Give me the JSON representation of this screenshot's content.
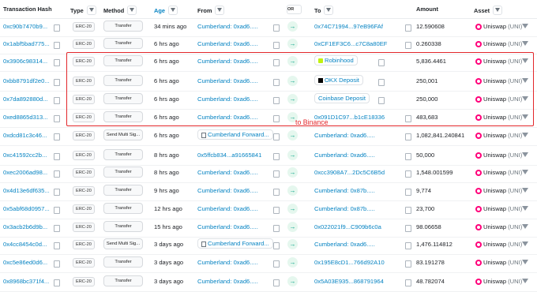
{
  "header": {
    "txhash": "Transaction Hash",
    "type": "Type",
    "method": "Method",
    "age": "Age",
    "from": "From",
    "or": "OR",
    "to": "To",
    "amount": "Amount",
    "asset": "Asset"
  },
  "annotation": "to Binance",
  "colors": {
    "link": "#0784c3",
    "highlight": "#e3272b",
    "in_arrow": "#00a186",
    "uniswap": "#ff007a"
  },
  "rows": [
    {
      "hash": "0xc90b7470b9...",
      "type": "ERC-20",
      "method": "Transfer",
      "age": "34 mins ago",
      "from": "Cumberland: 0xad6.....",
      "to": "0x74C71994...97eB96FAf",
      "amount": "12.590608",
      "asset": "Uniswap",
      "symbol": "(UNI)"
    },
    {
      "hash": "0x1abf5bad775...",
      "type": "ERC-20",
      "method": "Transfer",
      "age": "6 hrs ago",
      "from": "Cumberland: 0xad6.....",
      "to": "0xCF1EF3C6...c7C8a80EF",
      "amount": "0.260338",
      "asset": "Uniswap",
      "symbol": "(UNI)"
    },
    {
      "hash": "0x3906c98314...",
      "type": "ERC-20",
      "method": "Transfer",
      "age": "6 hrs ago",
      "from": "Cumberland: 0xad6.....",
      "to": "Robinhood",
      "amount": "5,836.4461",
      "asset": "Uniswap",
      "symbol": "(UNI)"
    },
    {
      "hash": "0xbb8791df2e0...",
      "type": "ERC-20",
      "method": "Transfer",
      "age": "6 hrs ago",
      "from": "Cumberland: 0xad6.....",
      "to": "OKX Deposit",
      "amount": "250,001",
      "asset": "Uniswap",
      "symbol": "(UNI)"
    },
    {
      "hash": "0x7da892880d...",
      "type": "ERC-20",
      "method": "Transfer",
      "age": "6 hrs ago",
      "from": "Cumberland: 0xad6.....",
      "to": "Coinbase Deposit",
      "amount": "250,000",
      "asset": "Uniswap",
      "symbol": "(UNI)"
    },
    {
      "hash": "0xed8865d313...",
      "type": "ERC-20",
      "method": "Transfer",
      "age": "6 hrs ago",
      "from": "Cumberland: 0xad6.....",
      "to": "0x091D1C97...b1cE18336",
      "amount": "483,683",
      "asset": "Uniswap",
      "symbol": "(UNI)"
    },
    {
      "hash": "0xdcd81c3c46...",
      "type": "ERC-20",
      "method": "Send Multi Sig...",
      "age": "6 hrs ago",
      "from": "Cumberland Forward...",
      "to": "Cumberland: 0xad6.....",
      "amount": "1,082,841.240841",
      "asset": "Uniswap",
      "symbol": "(UNI)"
    },
    {
      "hash": "0xc41592cc2b...",
      "type": "ERC-20",
      "method": "Transfer",
      "age": "8 hrs ago",
      "from": "0x5ffcb834...a91665841",
      "to": "Cumberland: 0xad6.....",
      "amount": "50,000",
      "asset": "Uniswap",
      "symbol": "(UNI)"
    },
    {
      "hash": "0xec2006ad98...",
      "type": "ERC-20",
      "method": "Transfer",
      "age": "8 hrs ago",
      "from": "Cumberland: 0xad6.....",
      "to": "0xcc3908A7...2Dc5C6B5d",
      "amount": "1,548.001599",
      "asset": "Uniswap",
      "symbol": "(UNI)"
    },
    {
      "hash": "0x4d13e6df635...",
      "type": "ERC-20",
      "method": "Transfer",
      "age": "9 hrs ago",
      "from": "Cumberland: 0xad6.....",
      "to": "Cumberland: 0x87b.....",
      "amount": "9,774",
      "asset": "Uniswap",
      "symbol": "(UNI)"
    },
    {
      "hash": "0x5abf68d0957...",
      "type": "ERC-20",
      "method": "Transfer",
      "age": "12 hrs ago",
      "from": "Cumberland: 0xad6.....",
      "to": "Cumberland: 0x87b.....",
      "amount": "23,700",
      "asset": "Uniswap",
      "symbol": "(UNI)"
    },
    {
      "hash": "0x3acb2b6d9b...",
      "type": "ERC-20",
      "method": "Transfer",
      "age": "15 hrs ago",
      "from": "Cumberland: 0xad6.....",
      "to": "0x022021f9...C909b6c0a",
      "amount": "98.06658",
      "asset": "Uniswap",
      "symbol": "(UNI)"
    },
    {
      "hash": "0x4cc8454c0d...",
      "type": "ERC-20",
      "method": "Send Multi Sig...",
      "age": "3 days ago",
      "from": "Cumberland Forward...",
      "to": "Cumberland: 0xad6.....",
      "amount": "1,476.114812",
      "asset": "Uniswap",
      "symbol": "(UNI)"
    },
    {
      "hash": "0xc5e86ed0d6...",
      "type": "ERC-20",
      "method": "Transfer",
      "age": "3 days ago",
      "from": "Cumberland: 0xad6.....",
      "to": "0x195E8cD1...766d92A10",
      "amount": "83.191278",
      "asset": "Uniswap",
      "symbol": "(UNI)"
    },
    {
      "hash": "0x8968bc371f4...",
      "type": "ERC-20",
      "method": "Transfer",
      "age": "3 days ago",
      "from": "Cumberland: 0xad6.....",
      "to": "0x5A03E935...868791964",
      "amount": "48.782074",
      "asset": "Uniswap",
      "symbol": "(UNI)"
    }
  ],
  "row_kinds": {
    "from_contract_rows": [
      6,
      12
    ],
    "to_tagged_rows": {
      "2": "robinhood-icon",
      "3": "okx-icon",
      "4": ""
    }
  }
}
